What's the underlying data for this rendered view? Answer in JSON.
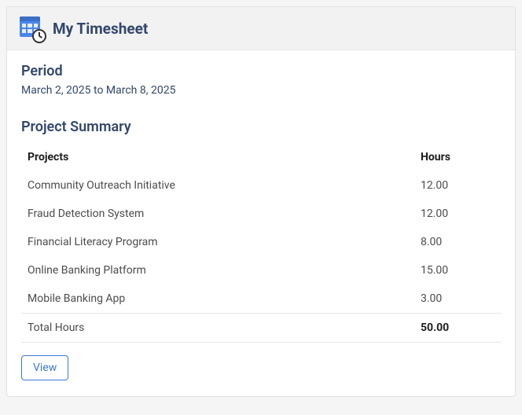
{
  "header": {
    "title": "My Timesheet"
  },
  "period": {
    "heading": "Period",
    "text": "March 2, 2025 to March 8, 2025"
  },
  "summary": {
    "heading": "Project Summary",
    "columns": {
      "project": "Projects",
      "hours": "Hours"
    },
    "rows": [
      {
        "project": "Community Outreach Initiative",
        "hours": "12.00"
      },
      {
        "project": "Fraud Detection System",
        "hours": "12.00"
      },
      {
        "project": "Financial Literacy Program",
        "hours": "8.00"
      },
      {
        "project": "Online Banking Platform",
        "hours": "15.00"
      },
      {
        "project": "Mobile Banking App",
        "hours": "3.00"
      }
    ],
    "total": {
      "label": "Total Hours",
      "hours": "50.00"
    }
  },
  "actions": {
    "view_label": "View"
  }
}
